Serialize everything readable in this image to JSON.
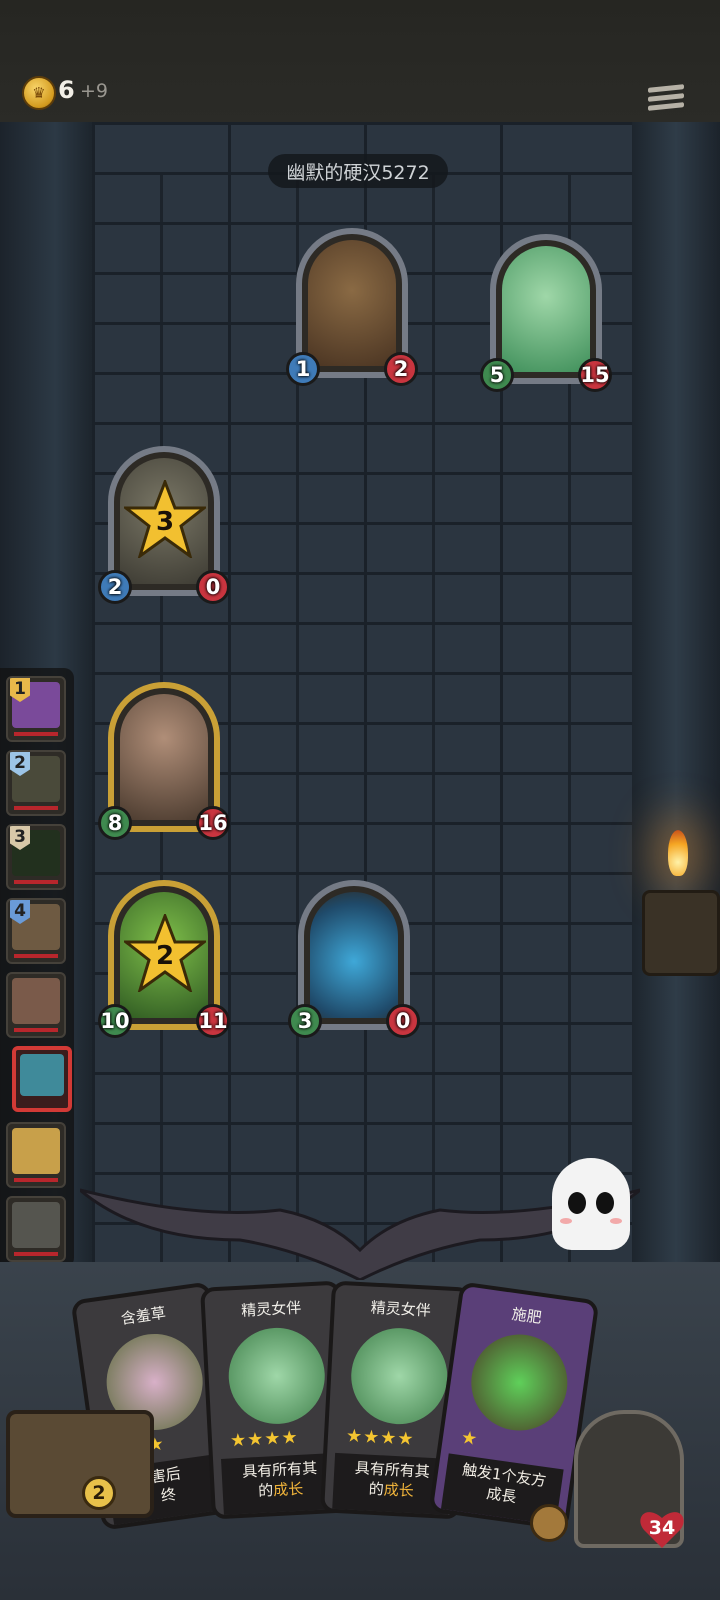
{
  "header": {
    "gold": "6",
    "gold_income": "+9",
    "menu_icon": "hamburger-menu-icon"
  },
  "opponent": {
    "name": "幽默的硬汉5272"
  },
  "board": [
    {
      "id": "enemy-totem",
      "atk": "1",
      "hp": "2"
    },
    {
      "id": "enemy-dryad",
      "atk": "5",
      "hp": "15"
    },
    {
      "id": "ally-stone-golem",
      "atk": "2",
      "hp": "0",
      "star": "3"
    },
    {
      "id": "ally-brute",
      "atk": "8",
      "hp": "16"
    },
    {
      "id": "ally-plant",
      "atk": "10",
      "hp": "11",
      "star": "2"
    },
    {
      "id": "ally-blue-flame",
      "atk": "3",
      "hp": "0"
    }
  ],
  "queue": [
    {
      "rank": "1",
      "color": "#e8b84a"
    },
    {
      "rank": "2",
      "color": "#9cc4e6"
    },
    {
      "rank": "3",
      "color": "#d8c8a8"
    },
    {
      "rank": "4",
      "color": "#6a9bd8"
    },
    {
      "rank": ""
    },
    {
      "rank": ""
    },
    {
      "rank": ""
    },
    {
      "rank": ""
    }
  ],
  "hand": [
    {
      "title": "含羞草",
      "stars": "★★★",
      "desc_pre": "害后",
      "desc_hl": "",
      "desc_post": "终"
    },
    {
      "title": "精灵女伴",
      "stars": "★★★★",
      "desc_pre": "具有所有其",
      "desc_hl": "成长",
      "desc_post": "的"
    },
    {
      "title": "精灵女伴",
      "stars": "★★★★",
      "desc_pre": "具有所有其",
      "desc_hl": "成长",
      "desc_post": "的"
    },
    {
      "title": "施肥",
      "stars": "★",
      "desc_pre": "触发1个友方",
      "desc_hl": "",
      "desc_post": "成長"
    }
  ],
  "deck_count": "2",
  "hero_hp": "34",
  "colors": {
    "hp_red": "#c9353f",
    "atk_blue": "#3f7bb8",
    "star_gold": "#f2c030"
  }
}
